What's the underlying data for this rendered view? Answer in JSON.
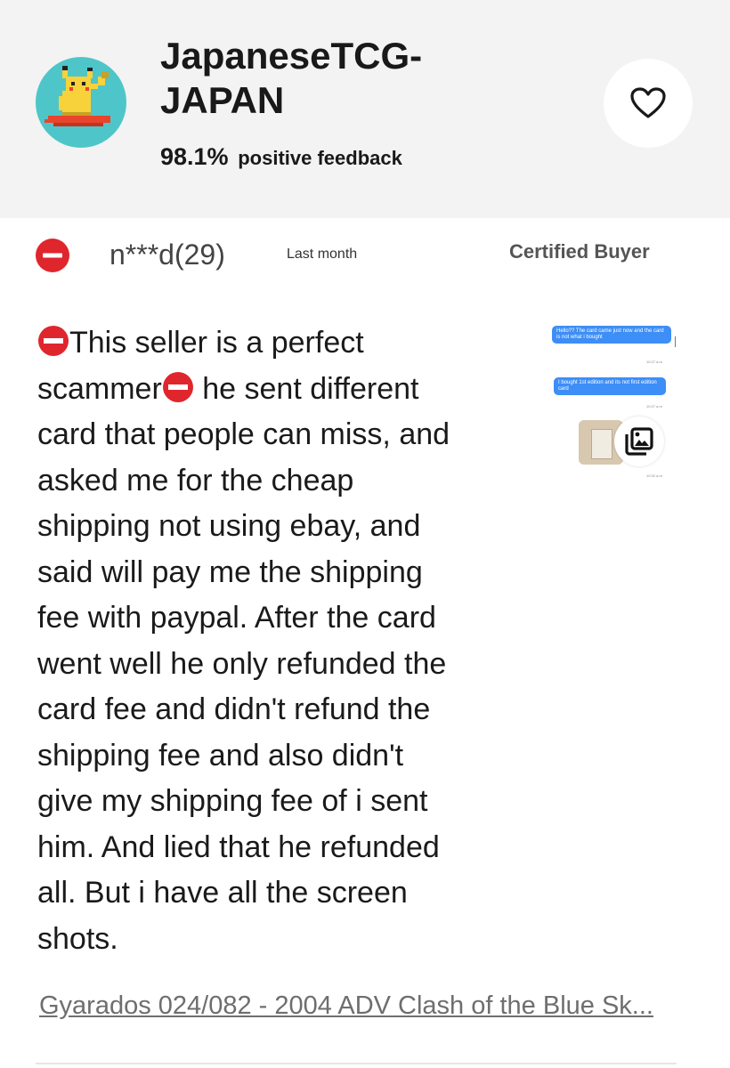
{
  "seller": {
    "name_line1": "JapaneseTCG-",
    "name_line2": "JAPAN",
    "feedback_percent": "98.1%",
    "feedback_label": "positive feedback",
    "avatar_icon": "pikachu-surfing-pixel-avatar",
    "heart_icon": "heart-outline-icon"
  },
  "review": {
    "rating_icon": "negative-feedback-icon",
    "reviewer": "n***d(29)",
    "time": "Last month",
    "badge": "Certified Buyer",
    "text_lines": [
      "This seller is a perfect",
      "scammer",
      " he sent different",
      "card that people can miss, and",
      "asked me for the cheap",
      "shipping not using ebay, and",
      "said will pay me the shipping",
      "fee with paypal. After the card",
      "went well he only refunded the",
      "card fee and didn't refund the",
      "shipping fee and also didn't",
      "give my shipping fee of i sent",
      "him. And lied that he refunded",
      "all. But i have all the screen",
      "shots."
    ],
    "screenshot": {
      "bubble1": "Hello?? The card came just now and the card is not what i bought",
      "time1": "10:27 a.m",
      "bubble2": "I bought 1st edition and its not first edition card",
      "time2": "10:27 a.m",
      "time3": "10:32 a.m",
      "gallery_icon": "image-gallery-icon"
    }
  },
  "item": {
    "link_text": "Gyarados 024/082 - 2004 ADV Clash of the Blue Sk..."
  },
  "colors": {
    "header_bg": "#f3f3f3",
    "negative_red": "#e0262d",
    "bubble_blue": "#3d8ef6",
    "avatar_bg": "#4ec6c9"
  }
}
